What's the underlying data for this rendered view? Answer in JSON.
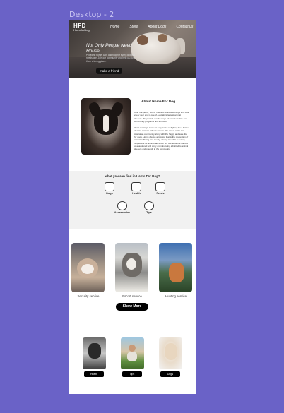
{
  "frame": {
    "title": "Desktop - 2"
  },
  "header": {
    "logo_mark": "HFD",
    "logo_sub": "HomeforDog",
    "nav": [
      "Home",
      "Store",
      "About Dogs",
      "Contact us"
    ]
  },
  "hero": {
    "headline": "Not Only People Need House",
    "subtext": "Providing home, care and food for every dog that needs one. Join our community and help us give them a loving place.",
    "cta_label": "make a friend"
  },
  "about": {
    "title": "About Home For Dog",
    "p1": "Over the years, 'HoFD' has had abandoned dogs and cats every year and is one of Australia's largest animal shelters. We provide a wide range of animal welfare and community programs and services.",
    "p2": "'For Lost Dogs' Home' is very active in fighting for a better deal for animals without owners. We aim to make the Australian community along with the happy and safe life for dogs. Home always a mission that is the prevention of animal suffering and cruelty, aiming to end in a society rangement for all animals which will decrease the number of abandoned and stray animals being admitted to animal shelters and pounds in the community."
  },
  "find": {
    "title": "what you can find in Home For Dog?",
    "categories": [
      {
        "label": "Dogs",
        "icon": "dog-icon"
      },
      {
        "label": "Health",
        "icon": "health-icon"
      },
      {
        "label": "Feeds",
        "icon": "feeds-icon"
      },
      {
        "label": "Accessories",
        "icon": "accessories-icon"
      },
      {
        "label": "Tips",
        "icon": "tips-icon"
      }
    ]
  },
  "services": {
    "items": [
      "Security service",
      "Escort service",
      "Hunting service"
    ],
    "show_more": "Show More"
  },
  "bottom": {
    "buttons": [
      "Health",
      "Tips",
      "Dogs"
    ]
  }
}
